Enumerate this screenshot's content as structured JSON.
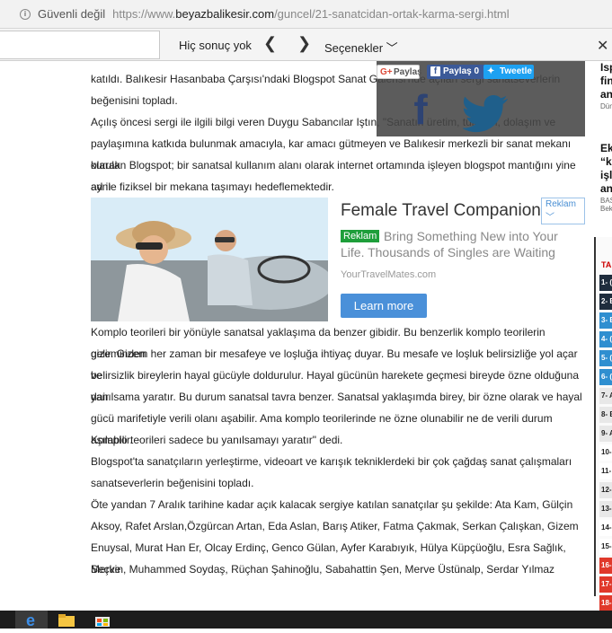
{
  "browser": {
    "security_label": "Güvenli değil",
    "url_prefix": "https://www.",
    "url_domain": "beyazbalikesir.com",
    "url_path": "/guncel/21-sanatcidan-ortak-karma-sergi.html"
  },
  "findbar": {
    "search_value": "",
    "result_text": "Hiç sonuç yok",
    "prev_glyph": "❮",
    "next_glyph": "❯",
    "options_label": "Seçenekler ﹀",
    "close_glyph": "✕"
  },
  "social": {
    "google_label": "Paylaş",
    "facebook_label": "Paylaş 0",
    "twitter_label": "Tweetle"
  },
  "article": {
    "p1_l0": "katıldı. Balıkesir Hasanbaba Çarşısı'ndaki Blogspot Sanat Galerisi'nde açılan sergi sanatseverlerin",
    "p1_l1": "beğenisini topladı.",
    "p2_l0": "Açılış öncesi sergi ile ilgili bilgi veren Duygu Sabancılar Iştın,  \"Sanatın üretim, tüketim, dolaşım ve",
    "p2_l1": "paylaşımına katkıda bulunmak amacıyla, kar amacı gütmeyen ve Balıkesir merkezli bir sanat mekanı olarak",
    "p2_l2": "kurulan Blogspot; bir sanatsal kullanım alanı olarak internet ortamında işleyen blogspot mantığını yine aynı",
    "p2_l3": "ad ile fiziksel bir mekana taşımayı hedeflemektedir.",
    "p3_l0": "Komplo teorileri bir yönüyle sanatsal yaklaşıma da benzer gibidir. Bu benzerlik komplo teorilerin gizeminden",
    "p3_l1": "gelir. Gizem her zaman bir mesafeye ve loşluğa ihtiyaç duyar. Bu mesafe ve loşluk belirsizliğe yol açar ve",
    "p3_l2": "belirsizlik bireylerin hayal gücüyle doldurulur. Hayal gücünün harekete geçmesi bireyde özne olduğuna dair",
    "p3_l3": "yanılsama yaratır. Bu durum sanatsal tavra benzer. Sanatsal yaklaşımda birey, bir özne olarak ve hayal",
    "p3_l4": "gücü marifetiyle verili olanı aşabilir.  Ama komplo teorilerinde ne özne olunabilir ne de verili durum aşılabilir.",
    "p3_l5": "Komplo teorileri sadece bu yanılsamayı yaratır\" dedi.",
    "p4_l0": "Blogspot'ta sanatçıların yerleştirme, videoart ve karışık tekniklerdeki bir çok çağdaş sanat çalışmaları",
    "p4_l1": "sanatseverlerin beğenisini topladı.",
    "p5_l0": "Öte yandan 7 Aralık tarihine kadar açık kalacak sergiye katılan sanatçılar şu şekilde: Ata Kam, Gülçin",
    "p5_l1": "Aksoy, Rafet Arslan,Özgürcan Artan, Eda Aslan, Barış Atiker, Fatma Çakmak, Serkan Çalışkan, Gizem",
    "p5_l2": "Enuysal, Murat Han Er, Olcay Erdinç, Genco Gülan, Ayfer Karabıyık, Hülya Küpçüoğlu, Esra Sağlık, Merve",
    "p5_l3": "Seçkin, Muhammed Soydaş, Rüçhan Şahinoğlu, Sabahattin Şen, Merve Üstünalp, Serdar Yılmaz"
  },
  "ad": {
    "title": "Female Travel Companion?",
    "badge": "Reklam ﹀",
    "label": "Reklam",
    "description": "Bring Something New into Your Life. Thousands of Singles are Waiting",
    "site": "YourTravelMates.com",
    "cta": "Learn more"
  },
  "sidebar": {
    "news1_l0": "Isp",
    "news1_l1": "fin",
    "news1_l2": "an",
    "news1_src": "Dün",
    "news2_l0": "Ek",
    "news2_l1": "“k",
    "news2_l2": "işl",
    "news2_l3": "an",
    "news2_src_l0": "BAS",
    "news2_src_l1": "Bek",
    "tab_label": "TA",
    "ranks": [
      "1- (",
      "2- E",
      "3- E",
      "4- (",
      "5- (",
      "6- (",
      "7- A",
      "8- E",
      "9- A",
      "10-",
      "11-",
      "12-",
      "13-",
      "14-",
      "15-",
      "16-",
      "17-",
      "18-"
    ]
  }
}
